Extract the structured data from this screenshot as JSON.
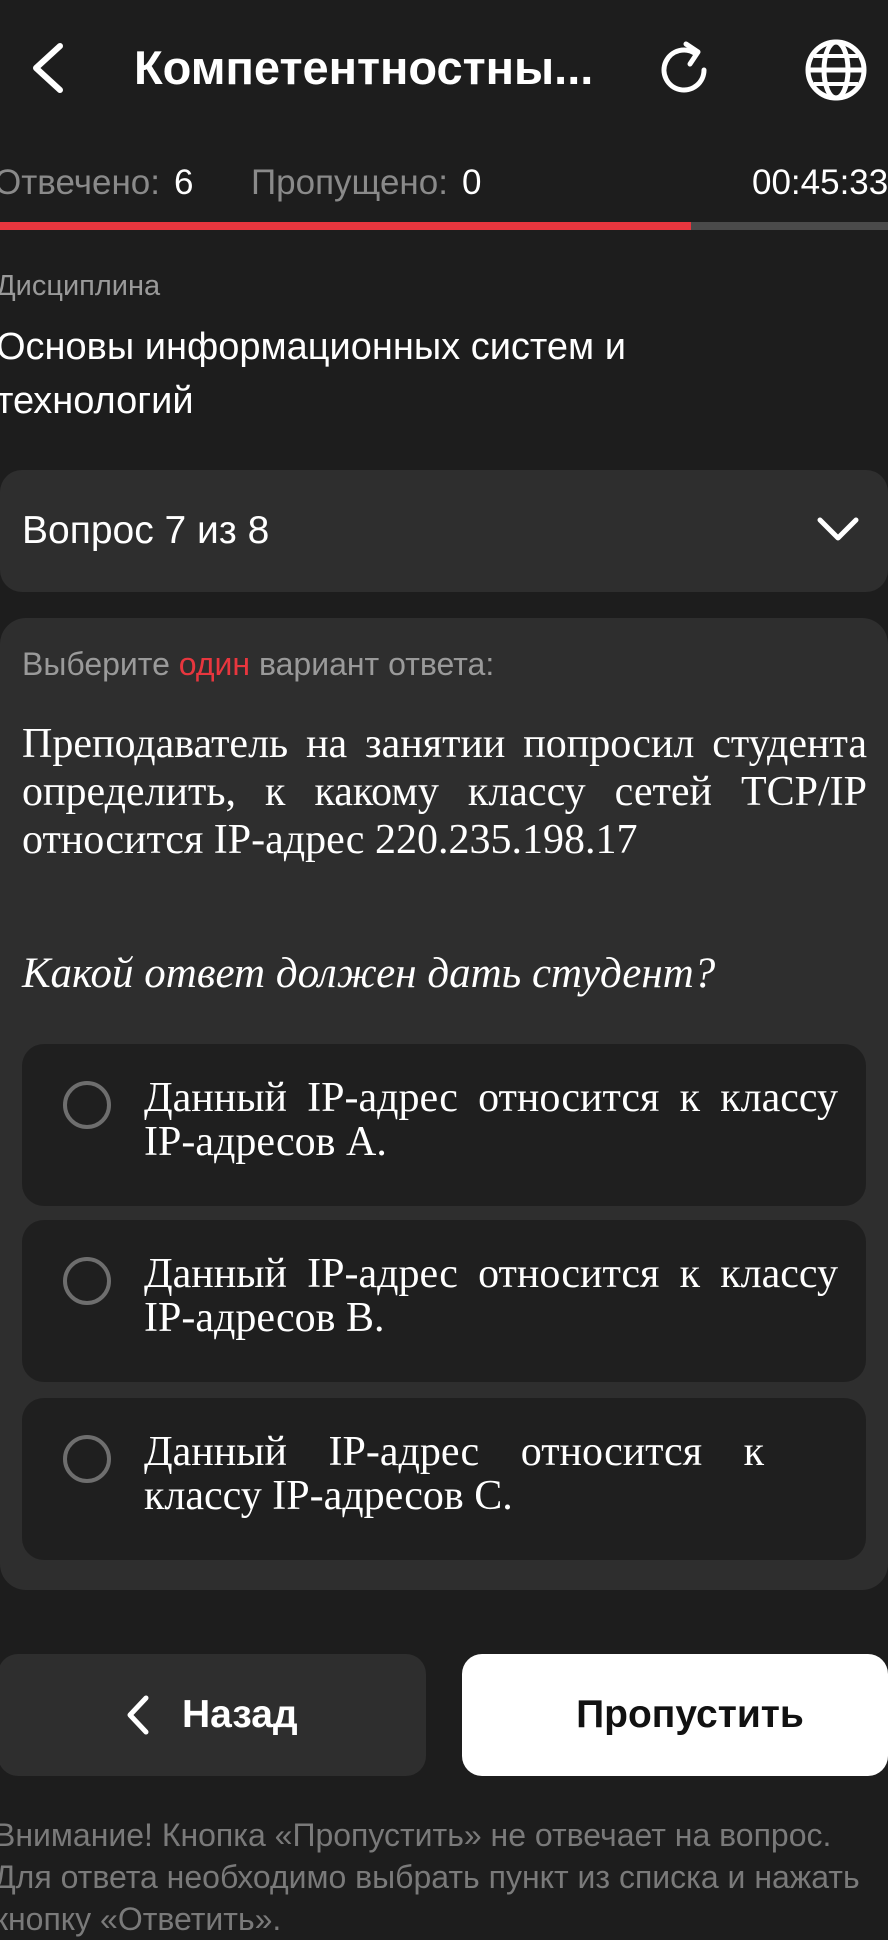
{
  "header": {
    "title": "Компетентностны...",
    "back_icon": "chevron-left-icon",
    "refresh_icon": "refresh-icon",
    "language_icon": "globe-icon"
  },
  "stats": {
    "answered_label": "Отвечено:",
    "answered_value": "6",
    "skipped_label": "Пропущено:",
    "skipped_value": "0",
    "timer": "00:45:33"
  },
  "progress": {
    "fraction": 0.778,
    "color": "#e8363e",
    "track_color": "#4a4a4a"
  },
  "discipline": {
    "label": "Дисциплина",
    "value": "Основы информационных систем и технологий"
  },
  "question_selector": {
    "label": "Вопрос 7 из 8",
    "icon": "chevron-down-icon"
  },
  "question": {
    "instruction_before": "Выберите ",
    "instruction_accent": "один",
    "instruction_after": " вариант ответа:",
    "text": "Преподаватель на занятии попросил студента определить, к какому классу сетей TCP/IP относится IP-адрес 220.235.198.17",
    "prompt": "Какой ответ должен дать студент?",
    "options": [
      {
        "label": "Данный IP-адрес относится к классу IP-адресов A.",
        "selected": false
      },
      {
        "label": "Данный IP-адрес относится к классу IP-адресов B.",
        "selected": false
      },
      {
        "label": "Данный IP-адрес относится к классу IP-адресов C.",
        "selected": false
      }
    ]
  },
  "buttons": {
    "back_label": "Назад",
    "skip_label": "Пропустить"
  },
  "notice": "Внимание! Кнопка «Пропустить» не отвечает на вопрос. Для ответа необходимо выбрать пункт из списка и нажать кнопку «Ответить».",
  "colors": {
    "background": "#1d1d1d",
    "card": "#2e2e2e",
    "accent": "#e8363e"
  }
}
